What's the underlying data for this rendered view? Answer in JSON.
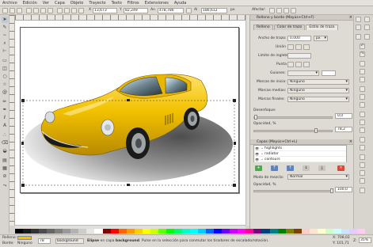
{
  "menu": [
    "Archivo",
    "Edición",
    "Ver",
    "Capa",
    "Objeto",
    "Trayecto",
    "Texto",
    "Filtros",
    "Extensiones",
    "Ayuda"
  ],
  "toolbar": {
    "x_label": "X",
    "x_value": "13,673",
    "y_label": "Y",
    "y_value": "82,249",
    "w_label": "An",
    "w_value": "478,786",
    "h_label": "Al",
    "h_value": "186,612",
    "unit": "px",
    "mode_label": "Afectar:"
  },
  "dock": {
    "fill_stroke_title": "Relleno y borde (Mayús+Ctrl+F)",
    "tabs": [
      "Relleno",
      "Color de trazo",
      "Estilo de trazo"
    ],
    "stroke_width_label": "Ancho de trazo:",
    "stroke_width_value": "0,000",
    "stroke_width_unit": "px",
    "join_label": "Unión",
    "miter_label": "Límite de inglete:",
    "cap_label": "Punta",
    "dashes_label": "Guiones:",
    "start_marker_label": "Marcas de inicio:",
    "start_marker_value": "Ninguno",
    "mid_marker_label": "Marcas medias:",
    "mid_marker_value": "Ninguno",
    "end_marker_label": "Marcas finales:",
    "end_marker_value": "Ninguno",
    "blur_label": "Desenfoque:",
    "blur_value": "0,0",
    "opacity_label": "Opacidad, %",
    "opacity_value": "78,2",
    "layers_title": "Capas (Mayús+Ctrl+L)",
    "layers": [
      "highlights",
      "radiator",
      "contours"
    ],
    "blend_label": "Modo de mezcla:",
    "blend_value": "Normal",
    "layer_opacity_label": "Opacidad, %",
    "layer_opacity_value": "100,0"
  },
  "status": {
    "fill_label": "Relleno:",
    "stroke_label": "Borde:",
    "stroke_value": "Ninguno",
    "opacity_value": "78",
    "layer_value": "background",
    "message_prefix": "Elipse",
    "message_mid": " en capa ",
    "message_layer": "background",
    "message_suffix": ". Pulse en la selección para conmutar los tiradores de escalado/rotación.",
    "x_readout": "X: 708,02",
    "y_readout": "Y: 101,71",
    "zoom_label": "Z:",
    "zoom_value": "35%"
  },
  "colors": {
    "car_yellow": "#f2c200",
    "car_shadow": "#b8860b",
    "ellipse_dark": "#6a6a6a",
    "palette": [
      "#000000",
      "#1a1a1a",
      "#333333",
      "#4d4d4d",
      "#666666",
      "#808080",
      "#999999",
      "#b3b3b3",
      "#cccccc",
      "#e6e6e6",
      "#ffffff",
      "#800000",
      "#ff0000",
      "#ff6600",
      "#ff9900",
      "#ffcc00",
      "#ffff00",
      "#ccff00",
      "#66ff00",
      "#00ff00",
      "#00ff66",
      "#00ffcc",
      "#00ffff",
      "#00ccff",
      "#0066ff",
      "#0000ff",
      "#6600ff",
      "#cc00ff",
      "#ff00ff",
      "#ff0099",
      "#800080",
      "#004080",
      "#008080",
      "#008000",
      "#808000",
      "#804000",
      "#ffcccc",
      "#ffe5cc",
      "#ffffcc",
      "#ccffcc",
      "#ccffff",
      "#cce5ff",
      "#e5ccff",
      "#ffccf0"
    ]
  }
}
